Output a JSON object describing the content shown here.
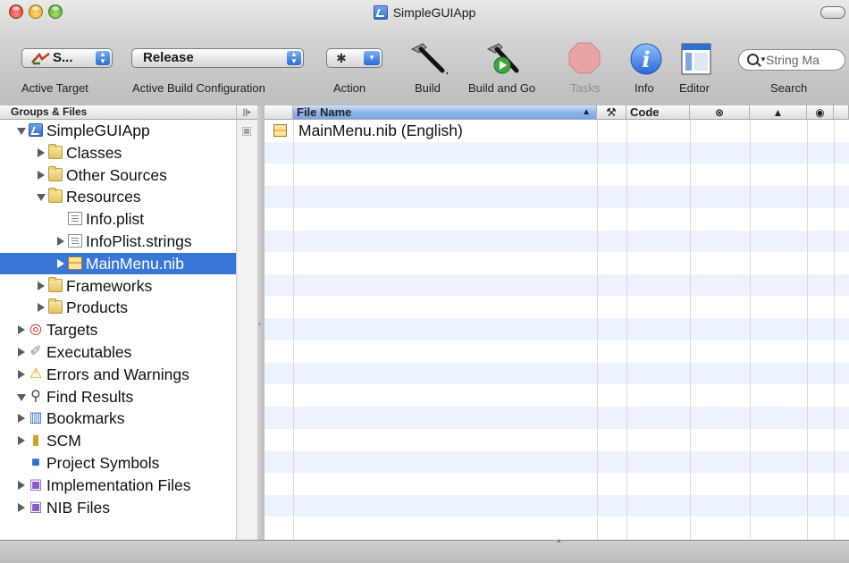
{
  "window": {
    "title": "SimpleGUIApp"
  },
  "toolbar": {
    "active_target": {
      "value": "S...",
      "label": "Active Target"
    },
    "build_config": {
      "value": "Release",
      "label": "Active Build Configuration"
    },
    "action": {
      "label": "Action"
    },
    "build": {
      "label": "Build"
    },
    "build_and_go": {
      "label": "Build and Go"
    },
    "tasks": {
      "label": "Tasks"
    },
    "info": {
      "label": "Info"
    },
    "editor": {
      "label": "Editor"
    },
    "search": {
      "label": "Search",
      "placeholder": "String Ma"
    }
  },
  "groups": {
    "header": "Groups & Files",
    "items": [
      {
        "label": "SimpleGUIApp",
        "icon": "project-icon",
        "disclosure": "open"
      },
      {
        "label": "Classes",
        "icon": "folder-icon",
        "disclosure": "closed"
      },
      {
        "label": "Other Sources",
        "icon": "folder-icon",
        "disclosure": "closed"
      },
      {
        "label": "Resources",
        "icon": "folder-icon",
        "disclosure": "open"
      },
      {
        "label": "Info.plist",
        "icon": "plist-file-icon",
        "disclosure": "none"
      },
      {
        "label": "InfoPlist.strings",
        "icon": "strings-file-icon",
        "disclosure": "closed"
      },
      {
        "label": "MainMenu.nib",
        "icon": "nib-file-icon",
        "disclosure": "closed",
        "selected": true
      },
      {
        "label": "Frameworks",
        "icon": "folder-icon",
        "disclosure": "closed"
      },
      {
        "label": "Products",
        "icon": "folder-icon",
        "disclosure": "closed"
      },
      {
        "label": "Targets",
        "icon": "target-icon",
        "disclosure": "closed"
      },
      {
        "label": "Executables",
        "icon": "executables-icon",
        "disclosure": "closed"
      },
      {
        "label": "Errors and Warnings",
        "icon": "warning-icon",
        "disclosure": "closed"
      },
      {
        "label": "Find Results",
        "icon": "magnifier-icon",
        "disclosure": "open"
      },
      {
        "label": "Bookmarks",
        "icon": "bookmarks-icon",
        "disclosure": "closed"
      },
      {
        "label": "SCM",
        "icon": "scm-icon",
        "disclosure": "closed"
      },
      {
        "label": "Project Symbols",
        "icon": "symbols-cube-icon",
        "disclosure": "none"
      },
      {
        "label": "Implementation Files",
        "icon": "smart-group-icon",
        "disclosure": "closed"
      },
      {
        "label": "NIB Files",
        "icon": "smart-group-icon",
        "disclosure": "closed"
      }
    ]
  },
  "file_list": {
    "columns": {
      "file_name": "File Name",
      "code": "Code"
    },
    "rows": [
      {
        "name": "MainMenu.nib (English)",
        "icon": "nib-file-icon"
      }
    ]
  },
  "colors": {
    "selection": "#3876d8",
    "alt_row": "#edf3fe",
    "column_active": "#8fb6ea"
  }
}
